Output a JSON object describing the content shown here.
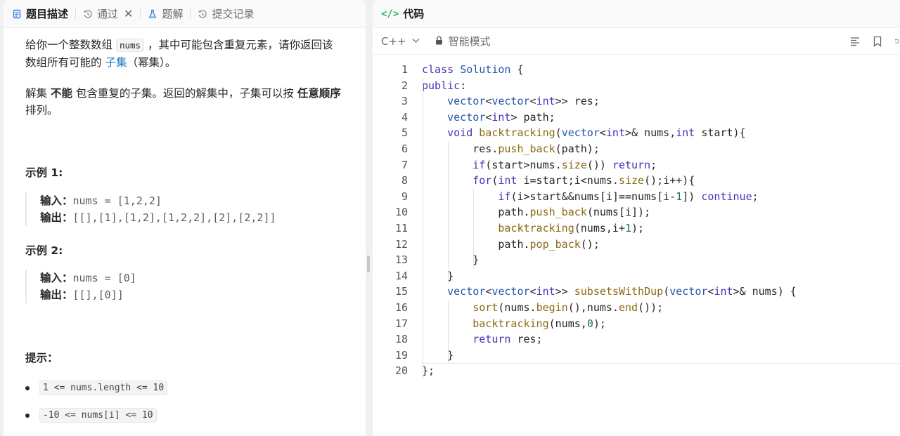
{
  "left_tabs": [
    {
      "label": "题目描述",
      "icon": "description-icon",
      "active": true
    },
    {
      "label": "通过",
      "icon": "history-icon",
      "active": false,
      "closable": true
    },
    {
      "label": "题解",
      "icon": "flask-icon",
      "active": false
    },
    {
      "label": "提交记录",
      "icon": "history-icon",
      "active": false
    }
  ],
  "close_glyph": "✕",
  "description": {
    "p1_a": "给你一个整数数组 ",
    "p1_code": "nums",
    "p1_b": " ，其中可能包含重复元素，请你返回该数组所有可能的 ",
    "p1_link": "子集",
    "p1_c": "（幂集）。",
    "p2_a": "解集 ",
    "p2_bold1": "不能",
    "p2_b": " 包含重复的子集。返回的解集中，子集可以按 ",
    "p2_bold2": "任意顺序",
    "p2_c": " 排列。"
  },
  "examples": [
    {
      "title": "示例 1:",
      "input_label": "输入：",
      "input": "nums = [1,2,2]",
      "output_label": "输出：",
      "output": "[[],[1],[1,2],[1,2,2],[2],[2,2]]"
    },
    {
      "title": "示例 2:",
      "input_label": "输入：",
      "input": "nums = [0]",
      "output_label": "输出：",
      "output": "[[],[0]]"
    }
  ],
  "hints": {
    "title": "提示：",
    "items": [
      "1 <= nums.length <= 10",
      "-10 <= nums[i] <= 10"
    ]
  },
  "code_panel": {
    "title": "代码",
    "language": "C++",
    "mode": "智能模式"
  },
  "code_lines": [
    "class Solution {",
    "public:",
    "    vector<vector<int>> res;",
    "    vector<int> path;",
    "    void backtracking(vector<int>& nums,int start){",
    "        res.push_back(path);",
    "        if(start>nums.size()) return;",
    "        for(int i=start;i<nums.size();i++){",
    "            if(i>start&&nums[i]==nums[i-1]) continue;",
    "            path.push_back(nums[i]);",
    "            backtracking(nums,i+1);",
    "            path.pop_back();",
    "        }",
    "    }",
    "    vector<vector<int>> subsetsWithDup(vector<int>& nums) {",
    "        sort(nums.begin(),nums.end());",
    "        backtracking(nums,0);",
    "        return res;",
    "    }",
    "};"
  ]
}
